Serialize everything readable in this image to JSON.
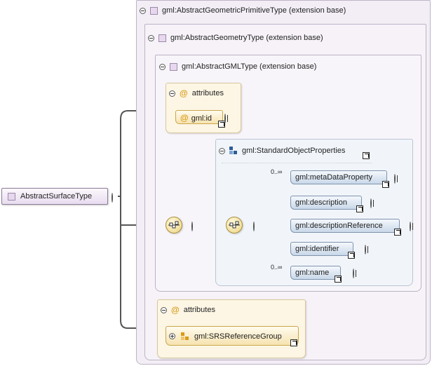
{
  "root": {
    "label": "AbstractSurfaceType"
  },
  "ext_boxes": [
    {
      "label": "gml:AbstractGeometricPrimitiveType (extension base)"
    },
    {
      "label": "gml:AbstractGeometryType (extension base)"
    },
    {
      "label": "gml:AbstractGMLType (extension base)"
    }
  ],
  "gml_attributes": {
    "label": "attributes",
    "id_attr": "gml:id",
    "at_symbol": "@"
  },
  "standard_props": {
    "label": "gml:StandardObjectProperties",
    "elements": [
      {
        "label": "gml:metaDataProperty",
        "cardinality": "0..∞"
      },
      {
        "label": "gml:description",
        "cardinality": ""
      },
      {
        "label": "gml:descriptionReference",
        "cardinality": ""
      },
      {
        "label": "gml:identifier",
        "cardinality": ""
      },
      {
        "label": "gml:name",
        "cardinality": "0..∞"
      }
    ]
  },
  "bottom_attributes": {
    "label": "attributes",
    "group": "gml:SRSReferenceGroup",
    "at_symbol": "@"
  }
}
